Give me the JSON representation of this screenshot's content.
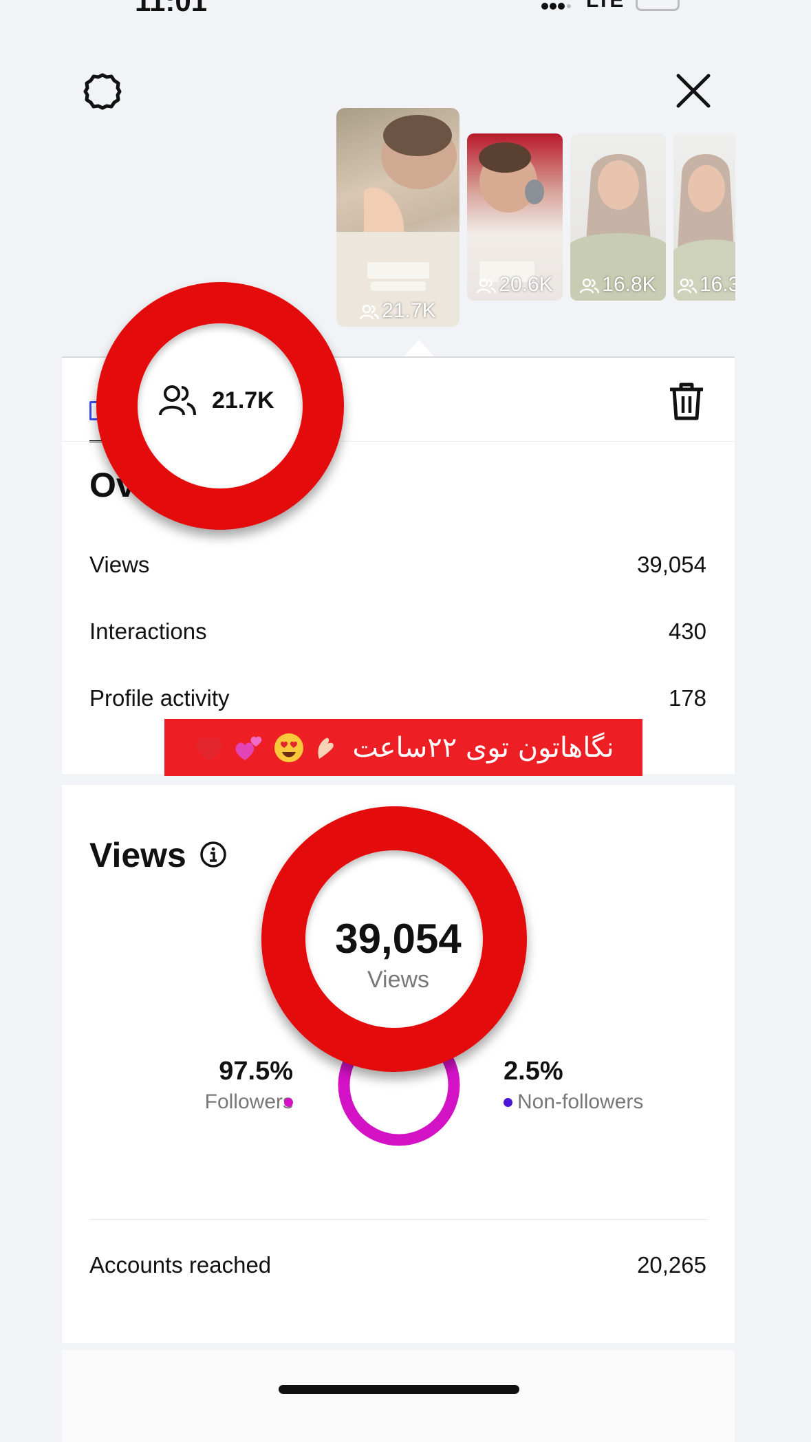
{
  "status_bar": {
    "time": "11:01",
    "network": "LTE"
  },
  "top_bar": {
    "settings_icon": "gear-icon",
    "close_icon": "close-icon"
  },
  "thumbnails": [
    {
      "count": "21.7K"
    },
    {
      "count": "20.6K"
    },
    {
      "count": "16.8K"
    },
    {
      "count": "16.3"
    }
  ],
  "selected_story": {
    "reach": "21.7K"
  },
  "overview": {
    "title": "Overview",
    "rows": [
      {
        "label": "Views",
        "value": "39,054"
      },
      {
        "label": "Interactions",
        "value": "430"
      },
      {
        "label": "Profile activity",
        "value": "178"
      }
    ]
  },
  "banner": {
    "text": "نگاهاتون توی ۲۲ساعت",
    "color": "#ed1f24"
  },
  "views": {
    "title": "Views",
    "total": "39,054",
    "total_label": "Views",
    "followers_pct": "97.5%",
    "followers_label": "Followers",
    "non_followers_pct": "2.5%",
    "non_followers_label": "Non-followers",
    "followers_fraction": 0.975,
    "colors": {
      "followers": "#d312c6",
      "non_followers": "#4b16d6"
    }
  },
  "accounts_reached": {
    "label": "Accounts reached",
    "value": "20,265"
  }
}
